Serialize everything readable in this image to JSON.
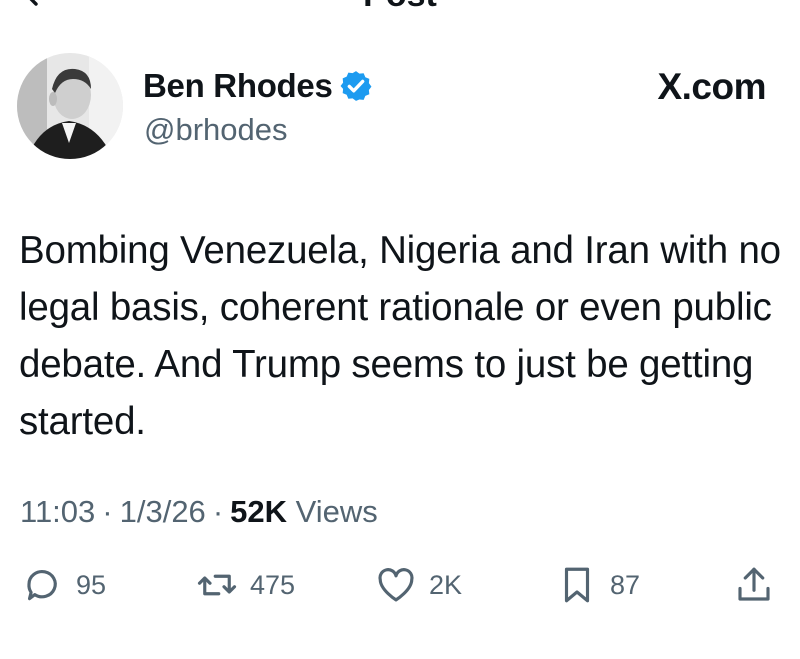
{
  "header": {
    "title": "Post"
  },
  "author": {
    "name": "Ben Rhodes",
    "handle": "@brhodes"
  },
  "watermark": "X.com",
  "tweet": {
    "text": "Bombing Venezuela, Nigeria and Iran with no legal basis, coherent rationale or even public debate. And Trump seems to just be getting started."
  },
  "meta": {
    "time": "11:03",
    "date": "1/3/26",
    "views_count": "52K",
    "views_label": "Views"
  },
  "actions": {
    "replies": "95",
    "reposts": "475",
    "likes": "2K",
    "bookmarks": "87"
  },
  "colors": {
    "verified": "#1d9bf0",
    "muted": "#536471",
    "text": "#0f1419"
  }
}
